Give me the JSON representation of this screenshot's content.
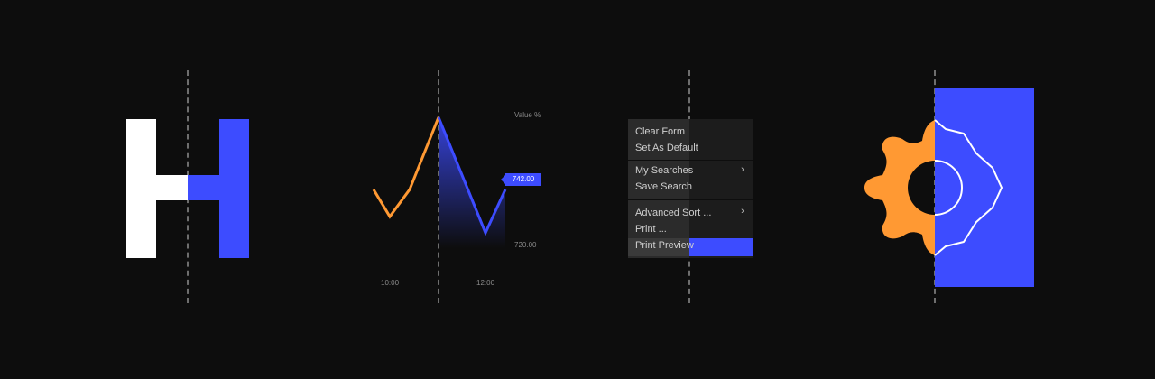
{
  "colors": {
    "background": "#0d0d0d",
    "accent_blue": "#3d4cff",
    "accent_orange": "#ff9933",
    "white": "#ffffff"
  },
  "chart": {
    "series_label": "Value %",
    "price_tag": "742.00",
    "y_tick_low": "720.00",
    "x_ticks": [
      "10:00",
      "12:00"
    ]
  },
  "context_menu": {
    "items": [
      {
        "label": "Clear Form"
      },
      {
        "label": "Set As Default"
      },
      {
        "label": "My Searches"
      },
      {
        "label": "Save Search"
      },
      {
        "label": "Advanced Sort ..."
      },
      {
        "label": "Print ..."
      },
      {
        "label": "Print Preview"
      }
    ]
  },
  "icons": {
    "letter": "letter-h-icon",
    "gear": "gear-icon",
    "submenu": "chevron-right-icon"
  }
}
